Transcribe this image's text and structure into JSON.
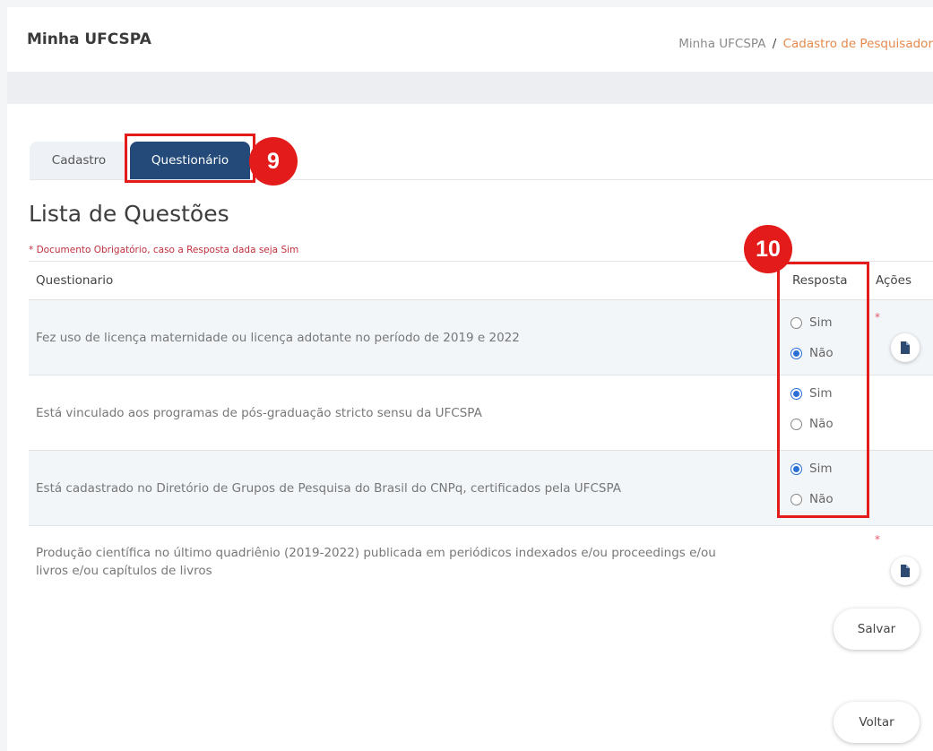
{
  "header": {
    "app_title": "Minha UFCSPA",
    "breadcrumb": {
      "home": "Minha UFCSPA",
      "separator": "/",
      "current": "Cadastro de Pesquisador"
    }
  },
  "tabs": [
    {
      "label": "Cadastro",
      "active": false
    },
    {
      "label": "Questionário",
      "active": true
    }
  ],
  "callouts": {
    "tab": "9",
    "respostas": "10"
  },
  "list": {
    "title": "Lista de Questões",
    "note": "* Documento Obrigatório, caso a Resposta dada seja Sim",
    "columns": {
      "question": "Questionario",
      "answer": "Resposta",
      "actions": "Ações"
    },
    "questions": [
      {
        "text": "Fez uso de licença maternidade ou licença adotante no período de 2019 e 2022",
        "answer": "Não",
        "required": "*"
      },
      {
        "text": "Está vinculado aos programas de pós-graduação stricto sensu da UFCSPA",
        "answer": "Sim"
      },
      {
        "text": "Está cadastrado no Diretório de Grupos de Pesquisa do Brasil do CNPq, certificados pela UFCSPA",
        "answer": "Sim"
      },
      {
        "text": "Produção científica no último quadriênio (2019-2022) publicada em periódicos indexados e/ou proceedings e/ou livros e/ou capítulos de livros",
        "required": "*"
      }
    ],
    "options": {
      "yes": "Sim",
      "no": "Não"
    }
  },
  "buttons": {
    "save": "Salvar",
    "back": "Voltar"
  },
  "icons": {
    "document": "document-icon"
  },
  "colors": {
    "tab_active": "#234a78",
    "accent": "#e5894d",
    "callout": "#e41b1b",
    "radio": "#2b6fd6"
  }
}
